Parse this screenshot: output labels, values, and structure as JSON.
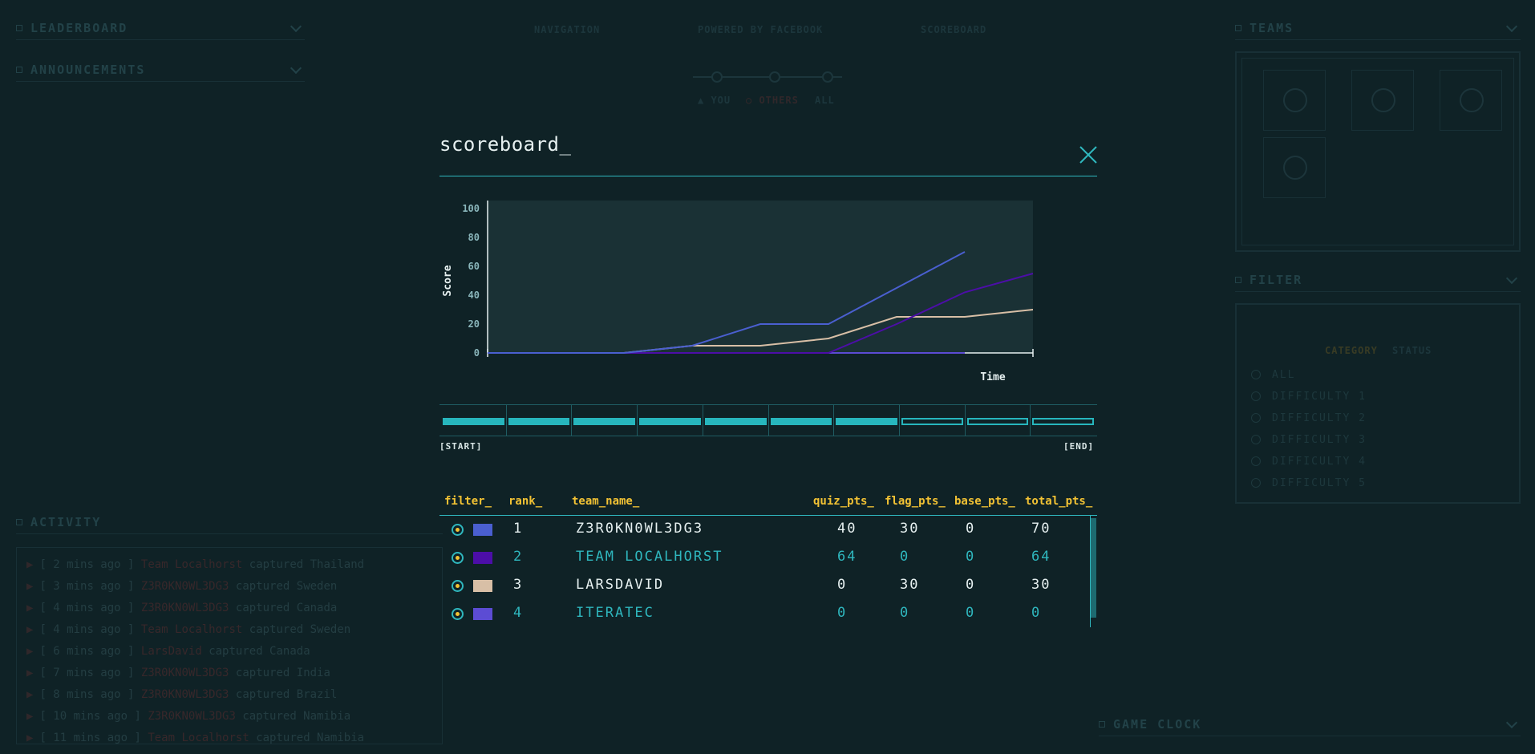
{
  "background": {
    "left_panels": [
      {
        "label": "LEADERBOARD"
      },
      {
        "label": "ANNOUNCEMENTS"
      },
      {
        "label": "ACTIVITY"
      }
    ],
    "right_panels": [
      {
        "label": "TEAMS"
      },
      {
        "label": "FILTER"
      },
      {
        "label": "GAME CLOCK"
      }
    ],
    "nav": {
      "navigation": "NAVIGATION",
      "powered": "POWERED BY FACEBOOK",
      "scoreboard": "SCOREBOARD",
      "you": "▲ YOU",
      "others": "○ OTHERS",
      "all": "ALL"
    },
    "activity": [
      {
        "time": "[ 2 mins ago ]",
        "who": "Team Localhorst",
        "what": "captured Thailand"
      },
      {
        "time": "[ 3 mins ago ]",
        "who": "Z3R0KN0WL3DG3",
        "what": "captured Sweden"
      },
      {
        "time": "[ 4 mins ago ]",
        "who": "Z3R0KN0WL3DG3",
        "what": "captured Canada"
      },
      {
        "time": "[ 4 mins ago ]",
        "who": "Team Localhorst",
        "what": "captured Sweden"
      },
      {
        "time": "[ 6 mins ago ]",
        "who": "LarsDavid",
        "what": "captured Canada"
      },
      {
        "time": "[ 7 mins ago ]",
        "who": "Z3R0KN0WL3DG3",
        "what": "captured India"
      },
      {
        "time": "[ 8 mins ago ]",
        "who": "Z3R0KN0WL3DG3",
        "what": "captured Brazil"
      },
      {
        "time": "[ 10 mins ago ]",
        "who": "Z3R0KN0WL3DG3",
        "what": "captured Namibia"
      },
      {
        "time": "[ 11 mins ago ]",
        "who": "Team Localhorst",
        "what": "captured Namibia"
      }
    ],
    "filter": {
      "tab_category": "CATEGORY",
      "tab_status": "STATUS",
      "options": [
        "ALL",
        "DIFFICULTY 1",
        "DIFFICULTY 2",
        "DIFFICULTY 3",
        "DIFFICULTY 4",
        "DIFFICULTY 5"
      ]
    }
  },
  "modal": {
    "title": "scoreboard_",
    "timeline": {
      "start_label": "[START]",
      "end_label": "[END]",
      "filled_segments": 7,
      "total_segments": 10
    },
    "table": {
      "headers": {
        "filter": "filter_",
        "rank": "rank_",
        "team_name": "team_name_",
        "quiz_pts": "quiz_pts_",
        "flag_pts": "flag_pts_",
        "base_pts": "base_pts_",
        "total_pts": "total_pts_"
      },
      "rows": [
        {
          "rank": "1",
          "team_name": "Z3R0KN0WL3DG3",
          "quiz_pts": "40",
          "flag_pts": "30",
          "base_pts": "0",
          "total_pts": "70",
          "color": "#4a5fd0",
          "text_color": "white"
        },
        {
          "rank": "2",
          "team_name": "TEAM LOCALHORST",
          "quiz_pts": "64",
          "flag_pts": "0",
          "base_pts": "0",
          "total_pts": "64",
          "color": "#4c0ea8",
          "text_color": "teal"
        },
        {
          "rank": "3",
          "team_name": "LARSDAVID",
          "quiz_pts": "0",
          "flag_pts": "30",
          "base_pts": "0",
          "total_pts": "30",
          "color": "#d8bfa6",
          "text_color": "white"
        },
        {
          "rank": "4",
          "team_name": "ITERATEC",
          "quiz_pts": "0",
          "flag_pts": "0",
          "base_pts": "0",
          "total_pts": "0",
          "color": "#5c4cd4",
          "text_color": "teal"
        }
      ]
    }
  },
  "chart_data": {
    "type": "line",
    "ylabel": "Score",
    "xlabel": "Time",
    "ylim": [
      0,
      100
    ],
    "yticks": [
      "0",
      "20",
      "40",
      "60",
      "80",
      "100"
    ],
    "x": [
      0,
      1,
      2,
      3,
      4,
      5,
      6,
      7,
      8
    ],
    "series": [
      {
        "name": "Z3R0KN0WL3DG3",
        "color": "#4a5fd0",
        "values": [
          0,
          0,
          0,
          5,
          20,
          20,
          45,
          70,
          null
        ]
      },
      {
        "name": "TEAM LOCALHORST",
        "color": "#4c0ea8",
        "values": [
          0,
          0,
          0,
          0,
          0,
          0,
          20,
          42,
          55
        ]
      },
      {
        "name": "LARSDAVID",
        "color": "#d8bfa6",
        "values": [
          0,
          0,
          0,
          5,
          5,
          10,
          25,
          25,
          30
        ]
      },
      {
        "name": "ITERATEC",
        "color": "#5c4cd4",
        "values": [
          0,
          0,
          0,
          0,
          0,
          0,
          0,
          0,
          null
        ]
      }
    ],
    "colors": {
      "plot_bg": "#1a3135",
      "axis": "#e6f0f0",
      "tick": "#8ab6bb"
    }
  }
}
